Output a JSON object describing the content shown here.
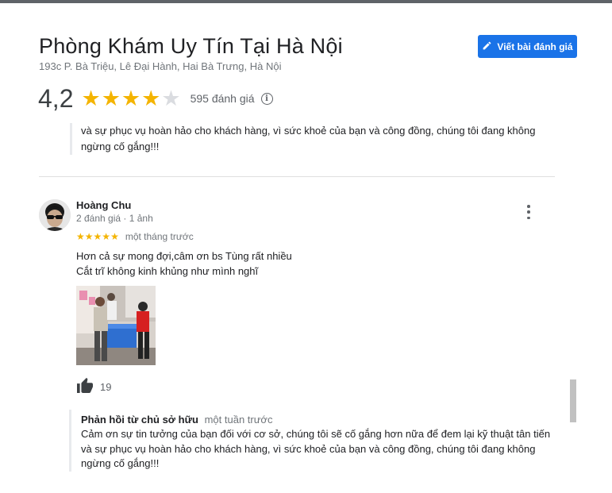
{
  "header": {
    "title": "Phòng Khám Uy Tín Tại Hà Nội",
    "address": "193c P. Bà Triệu, Lê Đại Hành, Hai Bà Trưng, Hà Nội",
    "write_review_label": "Viết bài đánh giá"
  },
  "summary": {
    "rating": "4,2",
    "rating_value": 4.2,
    "star_max": 5,
    "count_label": "595 đánh giá"
  },
  "previous_reply": {
    "text_line1": "và sự phục vụ hoàn hảo cho khách hàng, vì sức khoẻ của bạn và công đồng, chúng tôi đang không",
    "text_line2": "ngừng cố gắng!!!"
  },
  "review": {
    "author": "Hoàng Chu",
    "meta": "2 đánh giá · 1 ảnh",
    "stars": 5,
    "time": "một tháng trước",
    "text_line1": "Hơn cả sự mong đợi,câm ơn bs Tùng rất nhiều",
    "text_line2": "Cắt trĩ không kinh khủng như mình nghĩ",
    "likes": "19"
  },
  "owner_reply": {
    "label": "Phản hồi từ chủ sở hữu",
    "time": "một tuần trước",
    "text_line1": "Cảm ơn sự tin tưởng của bạn đối với cơ sở, chúng tôi sẽ cố gắng hơn nữa để đem lại kỹ thuật tân tiến",
    "text_line2": "và sự phục vụ hoàn hảo cho khách hàng, vì sức khoẻ của bạn và công đồng, chúng tôi đang không",
    "text_line3": "ngừng cố gắng!!!"
  },
  "colors": {
    "accent": "#1a73e8",
    "star": "#f4b400",
    "star_empty": "#dadce0"
  },
  "icons": {
    "write": "pencil-icon",
    "info": "info-icon",
    "more": "more-vert-icon",
    "like": "thumb-up-icon"
  }
}
